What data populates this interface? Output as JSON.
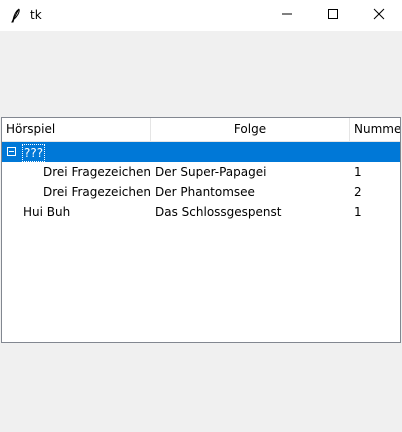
{
  "window": {
    "title": "tk"
  },
  "tree": {
    "columns": [
      "Hörspiel",
      "Folge",
      "Nummer"
    ],
    "rows": [
      {
        "hoerspiel": "???",
        "folge": "",
        "nummer": "",
        "expanded": true,
        "selected": true
      },
      {
        "hoerspiel": "Drei Fragezeichen",
        "folge": "Der Super-Papagei",
        "nummer": "1"
      },
      {
        "hoerspiel": "Drei Fragezeichen",
        "folge": "Der Phantomsee",
        "nummer": "2"
      },
      {
        "hoerspiel": "Hui Buh",
        "folge": "Das Schlossgespenst",
        "nummer": "1"
      }
    ]
  },
  "colors": {
    "selection": "#0078d7",
    "window_bg": "#f0f0f0"
  },
  "icons": {
    "app": "feather-icon",
    "minimize": "minimize-icon",
    "maximize": "maximize-icon",
    "close": "close-icon",
    "expander": "collapse-icon"
  }
}
